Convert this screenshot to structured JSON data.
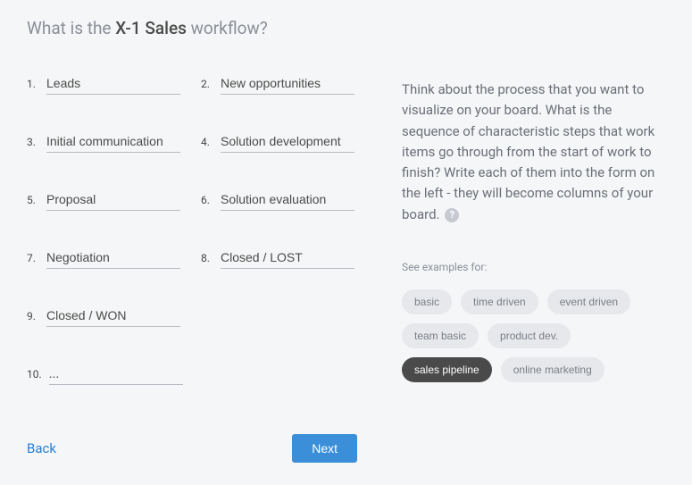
{
  "header": {
    "prefix": "What is the ",
    "highlight": "X-1 Sales",
    "suffix": " workflow?"
  },
  "workflow": {
    "items": [
      {
        "num": "1.",
        "value": "Leads"
      },
      {
        "num": "2.",
        "value": "New opportunities"
      },
      {
        "num": "3.",
        "value": "Initial communication"
      },
      {
        "num": "4.",
        "value": "Solution development"
      },
      {
        "num": "5.",
        "value": "Proposal"
      },
      {
        "num": "6.",
        "value": "Solution evaluation"
      },
      {
        "num": "7.",
        "value": "Negotiation"
      },
      {
        "num": "8.",
        "value": "Closed / LOST"
      },
      {
        "num": "9.",
        "value": "Closed / WON"
      },
      {
        "num": "10.",
        "value": "..."
      }
    ]
  },
  "sidebar": {
    "description": "Think about the process that you want to visualize on your board. What is the sequence of characteristic steps that work items go through from the start of work to finish? Write each of them into the form on the left - they will become columns of your board.",
    "examples_label": "See examples for:",
    "tags": [
      {
        "label": "basic",
        "active": false
      },
      {
        "label": "time driven",
        "active": false
      },
      {
        "label": "event driven",
        "active": false
      },
      {
        "label": "team basic",
        "active": false
      },
      {
        "label": "product dev.",
        "active": false
      },
      {
        "label": "sales pipeline",
        "active": true
      },
      {
        "label": "online marketing",
        "active": false
      }
    ]
  },
  "footer": {
    "back": "Back",
    "next": "Next"
  }
}
